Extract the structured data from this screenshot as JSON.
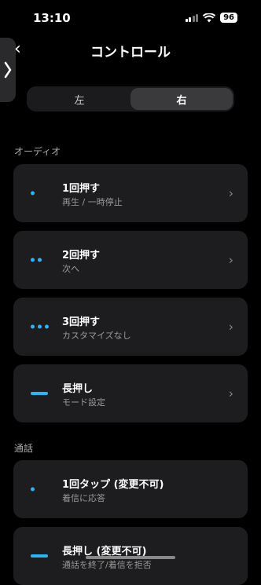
{
  "status": {
    "time": "13:10",
    "battery": "96"
  },
  "nav": {
    "title": "コントロール"
  },
  "tabs": [
    {
      "label": "左",
      "active": false
    },
    {
      "label": "右",
      "active": true
    }
  ],
  "sections": [
    {
      "header": "オーディオ",
      "items": [
        {
          "title": "1回押す",
          "subtitle": "再生 / 一時停止",
          "indicator": "one-dot"
        },
        {
          "title": "2回押す",
          "subtitle": "次へ",
          "indicator": "two-dots"
        },
        {
          "title": "3回押す",
          "subtitle": "カスタマイズなし",
          "indicator": "three-dots"
        },
        {
          "title": "長押し",
          "subtitle": "モード設定",
          "indicator": "long-bar"
        }
      ]
    },
    {
      "header": "通話",
      "items": [
        {
          "title": "1回タップ (変更不可)",
          "subtitle": "着信に応答",
          "indicator": "one-dot"
        },
        {
          "title": "長押し (変更不可)",
          "subtitle": "通話を終了/着信を拒否",
          "indicator": "long-bar"
        }
      ]
    }
  ],
  "colors": {
    "accent": "#29b6f6",
    "card": "#1d1d1f",
    "background": "#000000"
  }
}
